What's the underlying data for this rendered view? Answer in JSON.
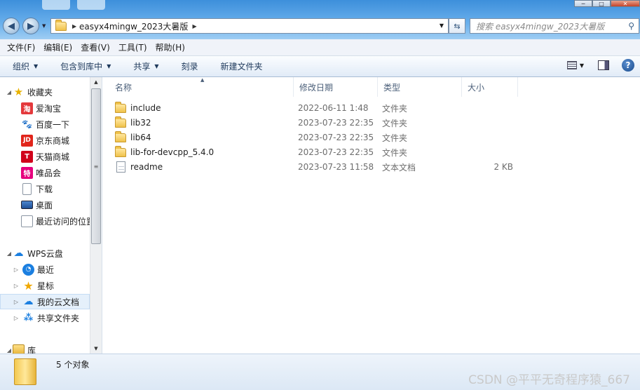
{
  "window": {
    "controls": {
      "minimize": "─",
      "maximize": "□",
      "close": "✕"
    }
  },
  "address": {
    "path": "easyx4mingw_2023大暑版",
    "search_placeholder": "搜索 easyx4mingw_2023大暑版"
  },
  "menu": [
    "文件(F)",
    "编辑(E)",
    "查看(V)",
    "工具(T)",
    "帮助(H)"
  ],
  "toolbar": {
    "organize": "组织",
    "include_in_library": "包含到库中",
    "share": "共享",
    "burn": "刻录",
    "new_folder": "新建文件夹"
  },
  "sidebar": {
    "favorites": {
      "label": "收藏夹",
      "items": [
        {
          "label": "爱淘宝",
          "icon": "taobao-icon",
          "glyph": "淘",
          "color": "#e4393c"
        },
        {
          "label": "百度一下",
          "icon": "baidu-icon",
          "glyph": "🐾",
          "color": "#2932e1"
        },
        {
          "label": "京东商城",
          "icon": "jd-icon",
          "glyph": "JD",
          "color": "#e1251b"
        },
        {
          "label": "天猫商城",
          "icon": "tmall-icon",
          "glyph": "T",
          "color": "#d0021b"
        },
        {
          "label": "唯品会",
          "icon": "vip-icon",
          "glyph": "特",
          "color": "#e6007e"
        },
        {
          "label": "下载",
          "icon": "download-icon",
          "glyph": "",
          "color": "#ffffff"
        },
        {
          "label": "桌面",
          "icon": "desktop-icon",
          "glyph": "",
          "color": "#2b5ea8"
        },
        {
          "label": "最近访问的位置",
          "icon": "recent-places-icon",
          "glyph": "",
          "color": "#ffffff"
        }
      ]
    },
    "wps": {
      "label": "WPS云盘",
      "items": [
        {
          "label": "最近",
          "icon": "clock-icon"
        },
        {
          "label": "星标",
          "icon": "star-icon"
        },
        {
          "label": "我的云文档",
          "icon": "cloud-doc-icon"
        },
        {
          "label": "共享文件夹",
          "icon": "shared-folder-icon"
        }
      ]
    },
    "libraries": {
      "label": "库"
    }
  },
  "columns": {
    "name": "名称",
    "modified": "修改日期",
    "type": "类型",
    "size": "大小"
  },
  "files": [
    {
      "name": "include",
      "modified": "2022-06-11 1:48",
      "type": "文件夹",
      "size": "",
      "kind": "folder"
    },
    {
      "name": "lib32",
      "modified": "2023-07-23 22:35",
      "type": "文件夹",
      "size": "",
      "kind": "folder"
    },
    {
      "name": "lib64",
      "modified": "2023-07-23 22:35",
      "type": "文件夹",
      "size": "",
      "kind": "folder"
    },
    {
      "name": "lib-for-devcpp_5.4.0",
      "modified": "2023-07-23 22:35",
      "type": "文件夹",
      "size": "",
      "kind": "folder"
    },
    {
      "name": "readme",
      "modified": "2023-07-23 11:58",
      "type": "文本文档",
      "size": "2 KB",
      "kind": "text"
    }
  ],
  "status": {
    "count": "5 个对象",
    "watermark": "CSDN @平平无奇程序猿_667"
  }
}
